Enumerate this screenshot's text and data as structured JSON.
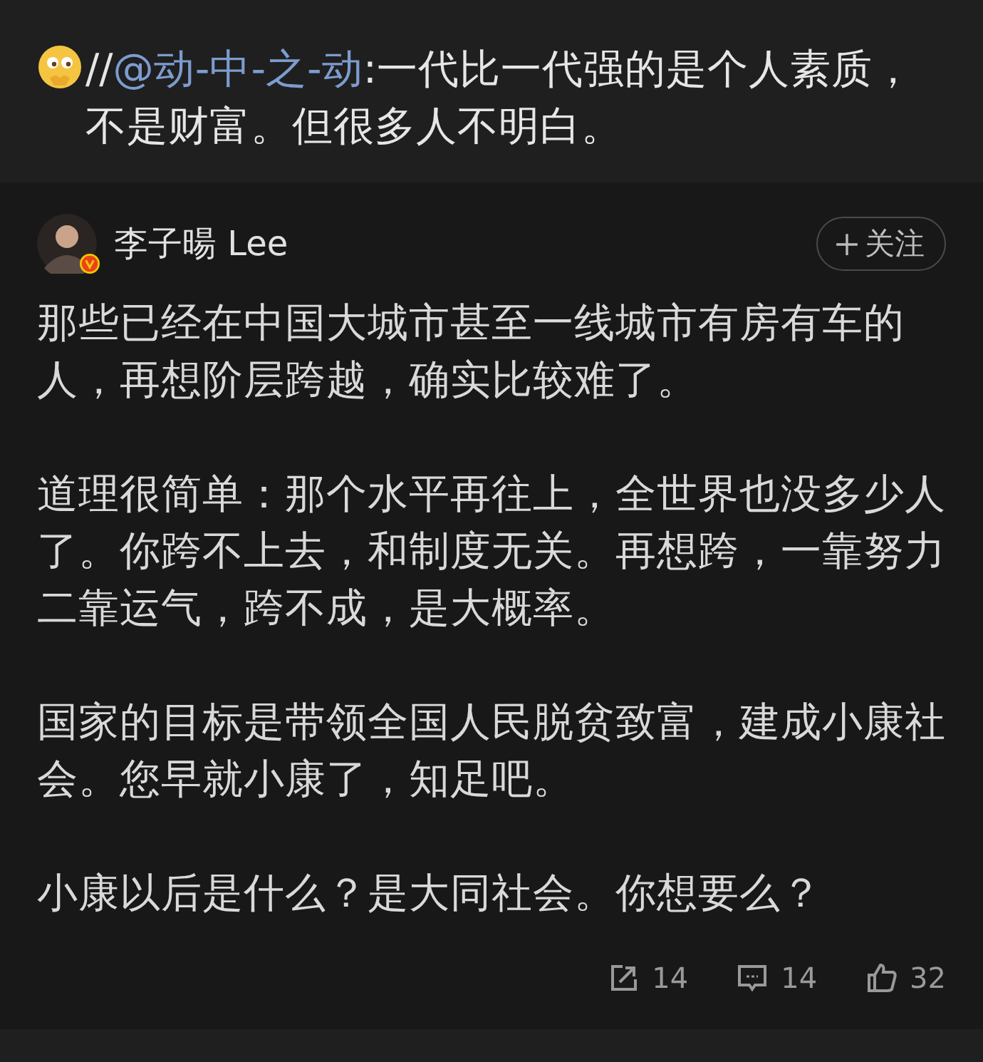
{
  "repost": {
    "prefix": "//",
    "mention": "@动-中-之-动",
    "text": ":一代比一代强的是个人素质，不是财富。但很多人不明白。"
  },
  "post": {
    "author": "李子暘 Lee",
    "verified": true,
    "follow_label": "关注",
    "paragraphs": [
      "那些已经在中国大城市甚至一线城市有房有车的人，再想阶层跨越，确实比较难了。",
      "道理很简单：那个水平再往上，全世界也没多少人了。你跨不上去，和制度无关。再想跨，一靠努力二靠运气，跨不成，是大概率。",
      "国家的目标是带领全国人民脱贫致富，建成小康社会。您早就小康了，知足吧。",
      "小康以后是什么？是大同社会。你想要么？"
    ],
    "actions": [
      {
        "kind": "share",
        "count": "14"
      },
      {
        "kind": "comment",
        "count": "14"
      },
      {
        "kind": "like",
        "count": "32"
      }
    ]
  }
}
